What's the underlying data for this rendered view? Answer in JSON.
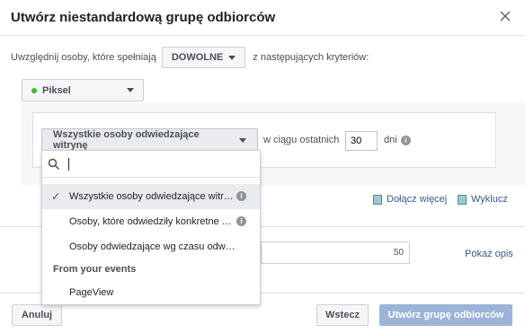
{
  "dialog": {
    "title": "Utwórz niestandardową grupę odbiorców"
  },
  "criteria": {
    "prefix": "Uwzględnij osoby, które spełniają",
    "match_label": "DOWOLNE",
    "suffix": "z następujących kryteriów:"
  },
  "source": {
    "label": "Piksel",
    "status_color": "#42b72a"
  },
  "rule": {
    "selected_option": "Wszystkie osoby odwiedzające witrynę",
    "within_label": "w ciągu ostatnich",
    "days_value": "30",
    "days_label": "dni"
  },
  "dropdown": {
    "search_value": "",
    "options": [
      {
        "label": "Wszystkie osoby odwiedzające witrynę",
        "selected": true
      },
      {
        "label": "Osoby, które odwiedziły konkretne strony"
      },
      {
        "label": "Osoby odwiedzające wg czasu odwiedzin"
      }
    ],
    "section_header": "From your events",
    "event_option": "PageView"
  },
  "links": {
    "include_more": "Dołącz więcej",
    "exclude": "Wyklucz"
  },
  "size": {
    "value": "50"
  },
  "show_description": "Pokaż opis",
  "footer": {
    "cancel": "Anuluj",
    "back": "Wstecz",
    "create": "Utwórz grupę odbiorców"
  }
}
